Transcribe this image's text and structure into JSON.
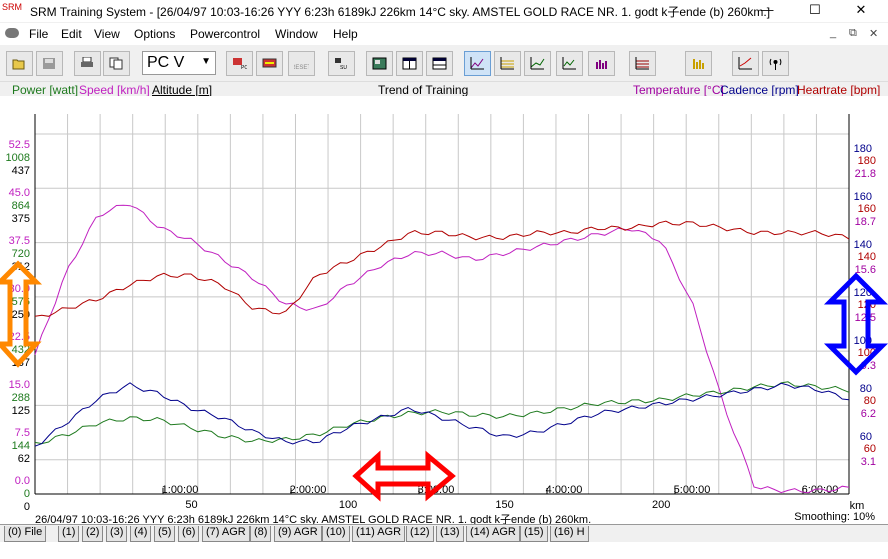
{
  "window": {
    "title": "SRM Training System - [26/04/97 10:03-16:26 YYY 6:23h 6189kJ 226km 14°C sky. AMSTEL GOLD RACE NR. 1. godt k子ende (b) 260km.]",
    "minimize": "—",
    "maximize": "☐",
    "close": "✕"
  },
  "menu": {
    "items": [
      "File",
      "Edit",
      "View",
      "Options",
      "Powercontrol",
      "Window",
      "Help"
    ]
  },
  "mdi": {
    "minimize": "_",
    "restore": "⧉",
    "close": "✕"
  },
  "toolbar": {
    "select_value": "PC V",
    "buttons": [
      {
        "name": "open-icon",
        "label": ""
      },
      {
        "name": "save-icon",
        "label": ""
      },
      {
        "name": "print-icon",
        "label": ""
      },
      {
        "name": "copy-icon",
        "label": ""
      },
      {
        "name": "pc-icon",
        "label": "PC"
      },
      {
        "name": "transfer-icon",
        "label": ""
      },
      {
        "name": "reset-icon",
        "label": "RESET"
      },
      {
        "name": "pc-su-icon",
        "label": "SU"
      }
    ]
  },
  "legend": {
    "power": "Power [watt]",
    "speed": "Speed [km/h]",
    "altitude": "Altitude [m]",
    "title": "Trend of Training",
    "temperature": "Temperature [°C]",
    "cadence": "Cadence [rpm]",
    "heartrate": "Heartrate [bpm]"
  },
  "colors": {
    "power": "#1e7a1e",
    "speed": "#c020c0",
    "altitude": "#000000",
    "cadence": "#00008b",
    "heartrate": "#b00000",
    "temperature": "#a000a0",
    "grid": "#c8c8c8",
    "arrow_left": "#ff8800",
    "arrow_right": "#0000ff",
    "arrow_bottom": "#ff0000"
  },
  "axes": {
    "left_speed": [
      "52.5",
      "45.0",
      "37.5",
      "30.0",
      "22.5",
      "15.0",
      "7.5",
      "0.0"
    ],
    "left_power": [
      "1008",
      "864",
      "720",
      "576",
      "432",
      "288",
      "144",
      "0"
    ],
    "left_alt": [
      "437",
      "375",
      "312",
      "250",
      "187",
      "125",
      "62",
      "0"
    ],
    "right_cadence": [
      "180",
      "160",
      "140",
      "120",
      "100",
      "80",
      "60"
    ],
    "right_heartrate": [
      "180",
      "160",
      "140",
      "120",
      "100",
      "80",
      "60"
    ],
    "right_temp": [
      "21.8",
      "18.7",
      "15.6",
      "12.5",
      "9.3",
      "6.2",
      "3.1"
    ],
    "km_ticks": [
      "50",
      "100",
      "150",
      "200"
    ],
    "time_ticks": [
      "1:00:00",
      "2:00:00",
      "3:00:00",
      "4:00:00",
      "5:00:00",
      "6:00:00"
    ],
    "km_unit": "km"
  },
  "chart_data": {
    "type": "line",
    "title": "Trend of Training",
    "x_unit": "km",
    "xlim": [
      0,
      260
    ],
    "series": [
      {
        "name": "Speed [km/h]",
        "x": [
          0,
          10,
          20,
          30,
          40,
          50,
          60,
          70,
          80,
          90,
          100,
          110,
          120,
          130,
          140,
          150,
          160,
          170,
          180,
          190,
          200,
          210,
          220,
          230,
          240,
          250,
          260
        ],
        "values": [
          22,
          35,
          44,
          46,
          42,
          40,
          37,
          34,
          30,
          29,
          33,
          36,
          38,
          38,
          37,
          38,
          39,
          40,
          41,
          42,
          40,
          30,
          14,
          1,
          0.5,
          0.5,
          1
        ]
      },
      {
        "name": "Heartrate [bpm]",
        "x": [
          0,
          10,
          20,
          30,
          40,
          50,
          60,
          70,
          80,
          90,
          100,
          110,
          120,
          130,
          140,
          150,
          160,
          170,
          180,
          190,
          200,
          210,
          220,
          230,
          240,
          250,
          260
        ],
        "values": [
          114,
          118,
          122,
          128,
          132,
          132,
          128,
          118,
          116,
          132,
          138,
          144,
          150,
          150,
          148,
          148,
          150,
          150,
          152,
          152,
          154,
          154,
          152,
          150,
          150,
          150,
          148
        ]
      },
      {
        "name": "Power [watt]",
        "x": [
          0,
          10,
          20,
          30,
          40,
          50,
          60,
          70,
          80,
          90,
          100,
          110,
          120,
          130,
          140,
          150,
          160,
          170,
          180,
          190,
          200,
          210,
          220,
          230,
          240,
          250,
          260
        ],
        "values": [
          150,
          180,
          215,
          230,
          225,
          200,
          175,
          160,
          165,
          180,
          210,
          230,
          245,
          250,
          240,
          235,
          245,
          260,
          275,
          280,
          285,
          300,
          310,
          325,
          335,
          325,
          315
        ]
      },
      {
        "name": "Cadence [rpm]",
        "x": [
          0,
          10,
          20,
          30,
          40,
          50,
          60,
          70,
          80,
          90,
          100,
          110,
          120,
          130,
          140,
          150,
          160,
          170,
          180,
          190,
          200,
          210,
          220,
          230,
          240,
          250,
          260
        ],
        "values": [
          60,
          70,
          80,
          86,
          82,
          76,
          72,
          66,
          62,
          62,
          68,
          72,
          76,
          72,
          68,
          64,
          66,
          70,
          74,
          76,
          78,
          80,
          82,
          84,
          86,
          84,
          80
        ]
      }
    ]
  },
  "status": {
    "text": "26/04/97 10:03-16:26 YYY 6:23h 6189kJ 226km 14°C sky. AMSTEL GOLD RACE NR. 1. godt k子ende (b) 260km.",
    "smoothing": "Smoothing: 10%"
  },
  "tabs": [
    "(0) File",
    "(1)",
    "(2)",
    "(3)",
    "(4)",
    "(5)",
    "(6)",
    "(7) AGR",
    "(8)",
    "(9) AGR",
    "(10)",
    "(11) AGR",
    "(12)",
    "(13)",
    "(14) AGR",
    "(15)",
    "(16) H"
  ]
}
